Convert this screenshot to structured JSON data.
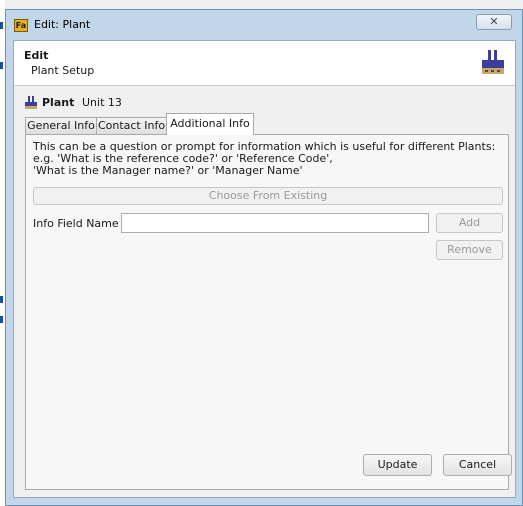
{
  "window": {
    "title": "Edit: Plant",
    "close_symbol": "✕",
    "app_icon": "app-logo-icon"
  },
  "header": {
    "title": "Edit",
    "subtitle": "Plant Setup",
    "icon": "factory-icon"
  },
  "entity": {
    "label": "Plant",
    "value": "Unit 13",
    "icon": "factory-icon"
  },
  "tabs": [
    {
      "label": "General Info",
      "active": false
    },
    {
      "label": "Contact Info",
      "active": false
    },
    {
      "label": "Additional Info",
      "active": true
    }
  ],
  "additional_info": {
    "description_lines": [
      "This can be a question or prompt for information which is useful for different Plants:",
      "e.g. 'What is the reference code?' or 'Reference Code',",
      "'What is the Manager name?' or 'Manager Name'"
    ],
    "choose_button": "Choose From Existing",
    "field_label": "Info Field Name",
    "field_value": "",
    "add_button": "Add",
    "remove_button": "Remove"
  },
  "footer": {
    "update_button": "Update",
    "cancel_button": "Cancel"
  },
  "colors": {
    "frame": "#c2d6ea",
    "app_icon": "#e8b21f",
    "factory_icon": "#3b3f9a"
  }
}
